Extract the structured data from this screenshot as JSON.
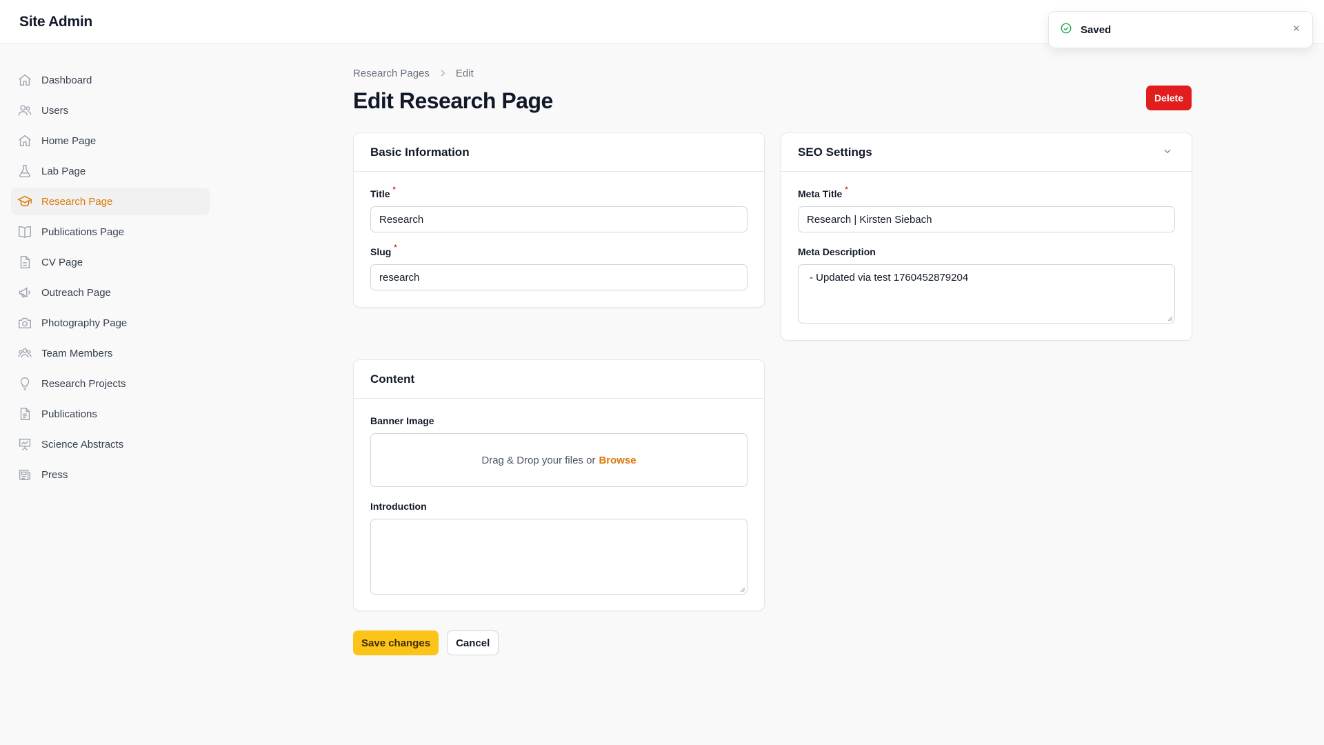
{
  "app": {
    "title": "Site Admin"
  },
  "sidebar": {
    "items": [
      {
        "label": "Dashboard",
        "icon": "home-icon"
      },
      {
        "label": "Users",
        "icon": "users-icon"
      },
      {
        "label": "Home Page",
        "icon": "home-icon"
      },
      {
        "label": "Lab Page",
        "icon": "beaker-icon"
      },
      {
        "label": "Research Page",
        "icon": "academic-cap-icon",
        "active": true
      },
      {
        "label": "Publications Page",
        "icon": "book-open-icon"
      },
      {
        "label": "CV Page",
        "icon": "document-icon"
      },
      {
        "label": "Outreach Page",
        "icon": "megaphone-icon"
      },
      {
        "label": "Photography Page",
        "icon": "camera-icon"
      },
      {
        "label": "Team Members",
        "icon": "user-group-icon"
      },
      {
        "label": "Research Projects",
        "icon": "light-bulb-icon"
      },
      {
        "label": "Publications",
        "icon": "document-text-icon"
      },
      {
        "label": "Science Abstracts",
        "icon": "presentation-chart-icon"
      },
      {
        "label": "Press",
        "icon": "newspaper-icon"
      }
    ]
  },
  "breadcrumb": {
    "parent": "Research Pages",
    "current": "Edit"
  },
  "page": {
    "title": "Edit Research Page",
    "delete_label": "Delete"
  },
  "basic_info": {
    "heading": "Basic Information",
    "title_label": "Title",
    "title_value": "Research",
    "slug_label": "Slug",
    "slug_value": "research"
  },
  "seo": {
    "heading": "SEO Settings",
    "meta_title_label": "Meta Title",
    "meta_title_value": "Research | Kirsten Siebach",
    "meta_description_label": "Meta Description",
    "meta_description_value": " - Updated via test 1760452879204"
  },
  "content": {
    "heading": "Content",
    "banner_label": "Banner Image",
    "dropzone_text": "Drag & Drop your files or",
    "browse_label": "Browse",
    "intro_label": "Introduction",
    "intro_value": ""
  },
  "actions": {
    "save_label": "Save changes",
    "cancel_label": "Cancel"
  },
  "toast": {
    "message": "Saved"
  },
  "colors": {
    "accent": "#d97706",
    "danger": "#e11d1d",
    "primary_button": "#fcc419",
    "success": "#16a34a"
  }
}
